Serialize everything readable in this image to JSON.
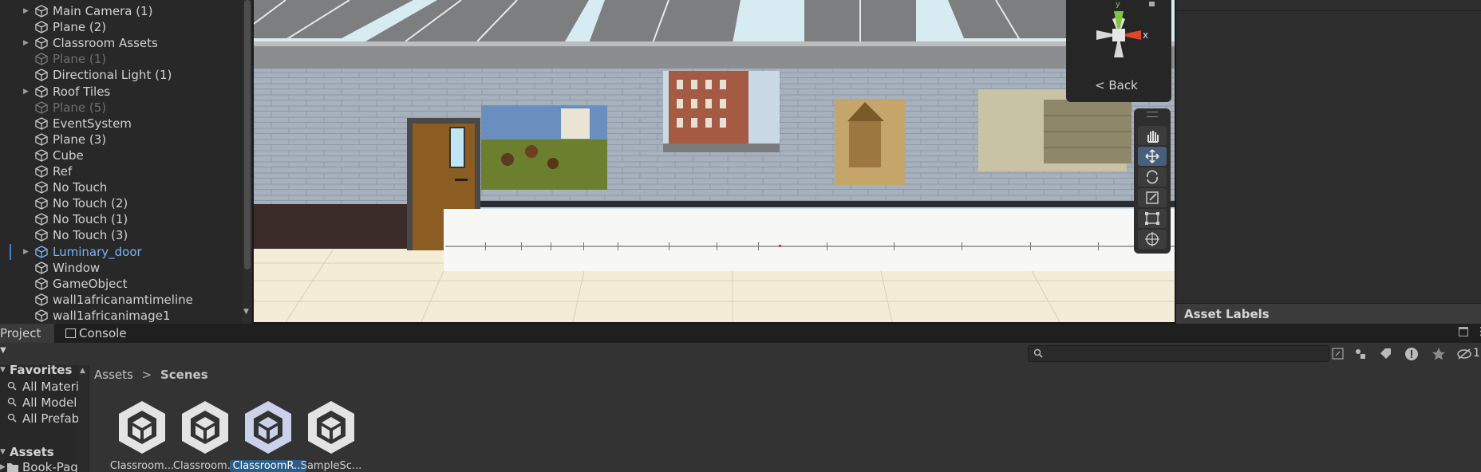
{
  "hierarchy": {
    "items": [
      {
        "label": "Main Camera (1)",
        "arrow": true,
        "state": "normal"
      },
      {
        "label": "Plane (2)",
        "arrow": false,
        "state": "normal"
      },
      {
        "label": "Classroom Assets",
        "arrow": true,
        "state": "normal"
      },
      {
        "label": "Plane (1)",
        "arrow": false,
        "state": "disabled"
      },
      {
        "label": "Directional Light (1)",
        "arrow": false,
        "state": "normal"
      },
      {
        "label": "Roof Tiles",
        "arrow": true,
        "state": "normal"
      },
      {
        "label": "Plane (5)",
        "arrow": false,
        "state": "disabled"
      },
      {
        "label": "EventSystem",
        "arrow": false,
        "state": "normal"
      },
      {
        "label": "Plane (3)",
        "arrow": false,
        "state": "normal"
      },
      {
        "label": "Cube",
        "arrow": false,
        "state": "normal"
      },
      {
        "label": "Ref",
        "arrow": false,
        "state": "normal"
      },
      {
        "label": "No Touch",
        "arrow": false,
        "state": "normal"
      },
      {
        "label": "No Touch (2)",
        "arrow": false,
        "state": "normal"
      },
      {
        "label": "No Touch (1)",
        "arrow": false,
        "state": "normal"
      },
      {
        "label": "No Touch (3)",
        "arrow": false,
        "state": "normal"
      },
      {
        "label": "Luminary_door",
        "arrow": true,
        "state": "prefab"
      },
      {
        "label": "Window",
        "arrow": false,
        "state": "normal"
      },
      {
        "label": "GameObject",
        "arrow": false,
        "state": "normal"
      },
      {
        "label": "wall1africanamtimeline",
        "arrow": false,
        "state": "normal"
      },
      {
        "label": "wall1africanimage1",
        "arrow": false,
        "state": "normal"
      }
    ]
  },
  "scene": {
    "gizmo": {
      "y_label": "y",
      "x_label": "x",
      "back_label": "< Back"
    },
    "tools": [
      "hand-tool",
      "move-tool",
      "rotate-tool",
      "scale-tool",
      "rect-tool",
      "transform-tool"
    ],
    "active_tool": "move-tool"
  },
  "inspector": {
    "asset_labels": "Asset Labels"
  },
  "tabs": [
    {
      "label": "Project",
      "icon": "folder-icon"
    },
    {
      "label": "Console",
      "icon": "console-icon"
    }
  ],
  "project": {
    "tree": [
      {
        "label": "Favorites",
        "kind": "header"
      },
      {
        "label": "All Materi",
        "kind": "search"
      },
      {
        "label": "All Model",
        "kind": "search"
      },
      {
        "label": "All Prefab",
        "kind": "search"
      },
      {
        "label": "Assets",
        "kind": "header"
      },
      {
        "label": "Book-Pag",
        "kind": "folder"
      }
    ],
    "breadcrumb": {
      "root": "Assets",
      "separator": ">",
      "current": "Scenes"
    },
    "search_placeholder": "",
    "hidden_count": "1",
    "assets": [
      {
        "label": "Classroom...",
        "selected": false
      },
      {
        "label": "Classroom...",
        "selected": false
      },
      {
        "label": "ClassroomR...",
        "selected": true
      },
      {
        "label": "SampleSc...",
        "selected": false
      }
    ]
  },
  "colors": {
    "accent": "#2c5d87",
    "prefab_text": "#7cb4f0",
    "gizmo_x": "#e0442c",
    "gizmo_y": "#7cc83c"
  }
}
